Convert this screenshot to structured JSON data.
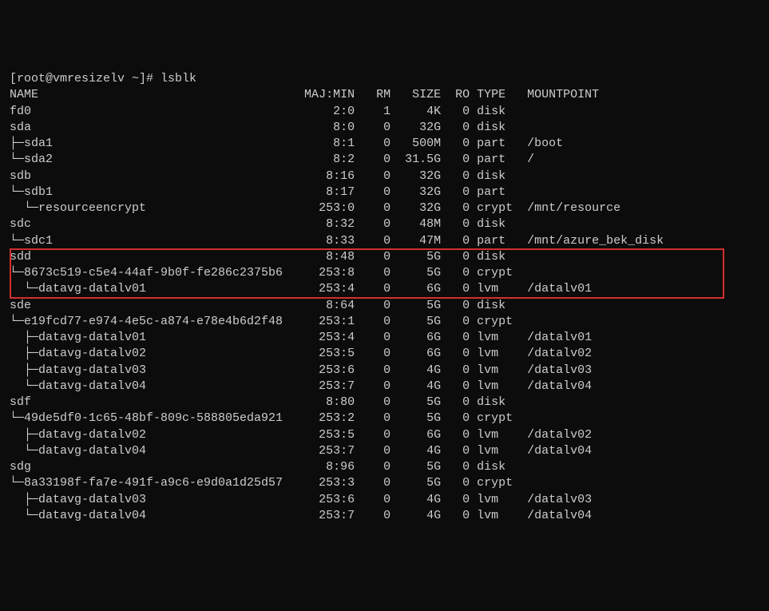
{
  "prompt": "[root@vmresizelv ~]# ",
  "command": "lsblk",
  "columns": {
    "name": "NAME",
    "majmin": "MAJ:MIN",
    "rm": "RM",
    "size": "SIZE",
    "ro": "RO",
    "type": "TYPE",
    "mountpoint": "MOUNTPOINT"
  },
  "rows": [
    {
      "name": "fd0",
      "majmin": "2:0",
      "rm": "1",
      "size": "4K",
      "ro": "0",
      "type": "disk",
      "mount": "",
      "boxstart": false,
      "boxend": false
    },
    {
      "name": "sda",
      "majmin": "8:0",
      "rm": "0",
      "size": "32G",
      "ro": "0",
      "type": "disk",
      "mount": "",
      "boxstart": false,
      "boxend": false
    },
    {
      "name": "├─sda1",
      "majmin": "8:1",
      "rm": "0",
      "size": "500M",
      "ro": "0",
      "type": "part",
      "mount": "/boot",
      "boxstart": false,
      "boxend": false
    },
    {
      "name": "└─sda2",
      "majmin": "8:2",
      "rm": "0",
      "size": "31.5G",
      "ro": "0",
      "type": "part",
      "mount": "/",
      "boxstart": false,
      "boxend": false
    },
    {
      "name": "sdb",
      "majmin": "8:16",
      "rm": "0",
      "size": "32G",
      "ro": "0",
      "type": "disk",
      "mount": "",
      "boxstart": false,
      "boxend": false
    },
    {
      "name": "└─sdb1",
      "majmin": "8:17",
      "rm": "0",
      "size": "32G",
      "ro": "0",
      "type": "part",
      "mount": "",
      "boxstart": false,
      "boxend": false
    },
    {
      "name": "  └─resourceencrypt",
      "majmin": "253:0",
      "rm": "0",
      "size": "32G",
      "ro": "0",
      "type": "crypt",
      "mount": "/mnt/resource",
      "boxstart": false,
      "boxend": false
    },
    {
      "name": "sdc",
      "majmin": "8:32",
      "rm": "0",
      "size": "48M",
      "ro": "0",
      "type": "disk",
      "mount": "",
      "boxstart": false,
      "boxend": false
    },
    {
      "name": "└─sdc1",
      "majmin": "8:33",
      "rm": "0",
      "size": "47M",
      "ro": "0",
      "type": "part",
      "mount": "/mnt/azure_bek_disk",
      "boxstart": false,
      "boxend": false
    },
    {
      "name": "sdd",
      "majmin": "8:48",
      "rm": "0",
      "size": "5G",
      "ro": "0",
      "type": "disk",
      "mount": "",
      "boxstart": true,
      "boxend": false
    },
    {
      "name": "└─8673c519-c5e4-44af-9b0f-fe286c2375b6",
      "majmin": "253:8",
      "rm": "0",
      "size": "5G",
      "ro": "0",
      "type": "crypt",
      "mount": "",
      "boxstart": false,
      "boxend": false
    },
    {
      "name": "  └─datavg-datalv01",
      "majmin": "253:4",
      "rm": "0",
      "size": "6G",
      "ro": "0",
      "type": "lvm",
      "mount": "/datalv01",
      "boxstart": false,
      "boxend": true
    },
    {
      "name": "sde",
      "majmin": "8:64",
      "rm": "0",
      "size": "5G",
      "ro": "0",
      "type": "disk",
      "mount": "",
      "boxstart": false,
      "boxend": false
    },
    {
      "name": "└─e19fcd77-e974-4e5c-a874-e78e4b6d2f48",
      "majmin": "253:1",
      "rm": "0",
      "size": "5G",
      "ro": "0",
      "type": "crypt",
      "mount": "",
      "boxstart": false,
      "boxend": false
    },
    {
      "name": "  ├─datavg-datalv01",
      "majmin": "253:4",
      "rm": "0",
      "size": "6G",
      "ro": "0",
      "type": "lvm",
      "mount": "/datalv01",
      "boxstart": false,
      "boxend": false
    },
    {
      "name": "  ├─datavg-datalv02",
      "majmin": "253:5",
      "rm": "0",
      "size": "6G",
      "ro": "0",
      "type": "lvm",
      "mount": "/datalv02",
      "boxstart": false,
      "boxend": false
    },
    {
      "name": "  ├─datavg-datalv03",
      "majmin": "253:6",
      "rm": "0",
      "size": "4G",
      "ro": "0",
      "type": "lvm",
      "mount": "/datalv03",
      "boxstart": false,
      "boxend": false
    },
    {
      "name": "  └─datavg-datalv04",
      "majmin": "253:7",
      "rm": "0",
      "size": "4G",
      "ro": "0",
      "type": "lvm",
      "mount": "/datalv04",
      "boxstart": false,
      "boxend": false
    },
    {
      "name": "sdf",
      "majmin": "8:80",
      "rm": "0",
      "size": "5G",
      "ro": "0",
      "type": "disk",
      "mount": "",
      "boxstart": false,
      "boxend": false
    },
    {
      "name": "└─49de5df0-1c65-48bf-809c-588805eda921",
      "majmin": "253:2",
      "rm": "0",
      "size": "5G",
      "ro": "0",
      "type": "crypt",
      "mount": "",
      "boxstart": false,
      "boxend": false
    },
    {
      "name": "  ├─datavg-datalv02",
      "majmin": "253:5",
      "rm": "0",
      "size": "6G",
      "ro": "0",
      "type": "lvm",
      "mount": "/datalv02",
      "boxstart": false,
      "boxend": false
    },
    {
      "name": "  └─datavg-datalv04",
      "majmin": "253:7",
      "rm": "0",
      "size": "4G",
      "ro": "0",
      "type": "lvm",
      "mount": "/datalv04",
      "boxstart": false,
      "boxend": false
    },
    {
      "name": "sdg",
      "majmin": "8:96",
      "rm": "0",
      "size": "5G",
      "ro": "0",
      "type": "disk",
      "mount": "",
      "boxstart": false,
      "boxend": false
    },
    {
      "name": "└─8a33198f-fa7e-491f-a9c6-e9d0a1d25d57",
      "majmin": "253:3",
      "rm": "0",
      "size": "5G",
      "ro": "0",
      "type": "crypt",
      "mount": "",
      "boxstart": false,
      "boxend": false
    },
    {
      "name": "  ├─datavg-datalv03",
      "majmin": "253:6",
      "rm": "0",
      "size": "4G",
      "ro": "0",
      "type": "lvm",
      "mount": "/datalv03",
      "boxstart": false,
      "boxend": false
    },
    {
      "name": "  └─datavg-datalv04",
      "majmin": "253:7",
      "rm": "0",
      "size": "4G",
      "ro": "0",
      "type": "lvm",
      "mount": "/datalv04",
      "boxstart": false,
      "boxend": false
    }
  ]
}
